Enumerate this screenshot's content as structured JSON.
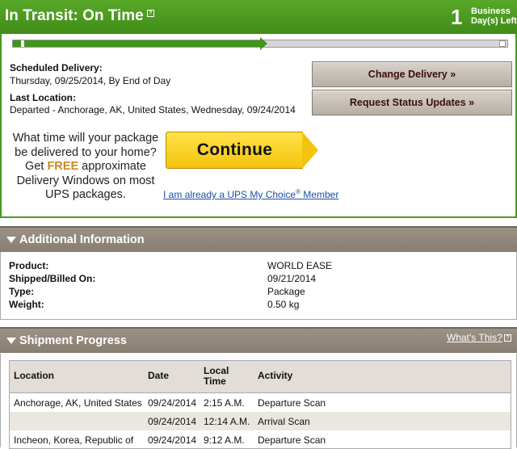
{
  "status": {
    "title": "In Transit: On Time",
    "help_glyph": "?",
    "days_count": "1",
    "days_label_line1": "Business",
    "days_label_line2": "Day(s) Left"
  },
  "delivery": {
    "progress_fraction": 0.5,
    "scheduled_label": "Scheduled Delivery:",
    "scheduled_value": "Thursday, 09/25/2014, By End of Day",
    "last_location_label": "Last Location:",
    "last_location_value": "Departed - Anchorage, AK, United States, Wednesday, 09/24/2014",
    "change_delivery_button": "Change Delivery »",
    "request_updates_button": "Request Status Updates »"
  },
  "promo": {
    "line1": "What time will your package",
    "line2": "be delivered to your home?",
    "line3_pre": "Get ",
    "line3_free": "FREE",
    "line3_post": " approximate",
    "line4": "Delivery Windows on most",
    "line5": "UPS packages.",
    "continue_button": "Continue",
    "member_link_pre": "I am already a UPS My Choice",
    "member_link_reg": "®",
    "member_link_post": " Member"
  },
  "additional_info": {
    "header": "Additional Information",
    "rows": [
      {
        "label": "Product:",
        "value": "WORLD EASE"
      },
      {
        "label": "Shipped/Billed On:",
        "value": "09/21/2014"
      },
      {
        "label": "Type:",
        "value": "Package"
      },
      {
        "label": "Weight:",
        "value": "0.50 kg"
      }
    ]
  },
  "shipment_progress": {
    "header": "Shipment Progress",
    "whats_this": "What's This?",
    "columns": {
      "location": "Location",
      "date": "Date",
      "local_time_line1": "Local",
      "local_time_line2": "Time",
      "activity": "Activity"
    },
    "rows": [
      {
        "location": "Anchorage, AK, United States",
        "date": "09/24/2014",
        "time": "2:15 A.M.",
        "activity": "Departure Scan"
      },
      {
        "location": "",
        "date": "09/24/2014",
        "time": "12:14 A.M.",
        "activity": "Arrival Scan"
      },
      {
        "location": "Incheon, Korea, Republic of",
        "date": "09/24/2014",
        "time": "9:12 A.M.",
        "activity": "Departure Scan"
      }
    ]
  },
  "colors": {
    "status_green": "#4a9a1f",
    "section_brown": "#8f8578",
    "button_text": "#3a0f0a",
    "continue_yellow": "#f4c40c",
    "free_orange": "#c8881a",
    "link_blue": "#1a4ea8"
  }
}
